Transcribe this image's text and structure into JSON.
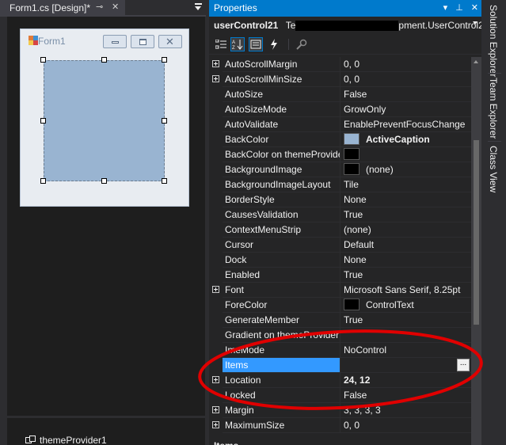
{
  "designer": {
    "tab_label": "Form1.cs [Design]*",
    "pin_icon": "pin-icon",
    "close_icon": "close-icon",
    "form": {
      "title": "Form1",
      "minimize_icon": "minimize-icon",
      "maximize_icon": "maximize-icon",
      "close_glyph": "✕"
    },
    "tray_component": "themeProvider1"
  },
  "properties": {
    "title": "Properties",
    "object_name": "userControl21",
    "object_type_prefix": "Te",
    "object_type_suffix": "pment.UserControl2",
    "toolbar": {
      "categorized_icon": "categorized-icon",
      "alphabetical_icon": "alphabetical-icon",
      "properties_icon": "properties-icon",
      "events_icon": "events-icon",
      "property-pages_icon": "property-pages-icon"
    },
    "rows": [
      {
        "name": "AutoScrollMargin",
        "value": "0, 0",
        "expandable": true
      },
      {
        "name": "AutoScrollMinSize",
        "value": "0, 0",
        "expandable": true
      },
      {
        "name": "AutoSize",
        "value": "False"
      },
      {
        "name": "AutoSizeMode",
        "value": "GrowOnly"
      },
      {
        "name": "AutoValidate",
        "value": "EnablePreventFocusChange"
      },
      {
        "name": "BackColor",
        "value": "ActiveCaption",
        "bold": true,
        "swatch": "#99b4d1"
      },
      {
        "name": "BackColor on themeProvider1",
        "value": "",
        "swatch": "#000000"
      },
      {
        "name": "BackgroundImage",
        "value": "(none)",
        "swatch": "#000000"
      },
      {
        "name": "BackgroundImageLayout",
        "value": "Tile"
      },
      {
        "name": "BorderStyle",
        "value": "None"
      },
      {
        "name": "CausesValidation",
        "value": "True"
      },
      {
        "name": "ContextMenuStrip",
        "value": "(none)"
      },
      {
        "name": "Cursor",
        "value": "Default"
      },
      {
        "name": "Dock",
        "value": "None"
      },
      {
        "name": "Enabled",
        "value": "True"
      },
      {
        "name": "Font",
        "value": "Microsoft Sans Serif, 8.25pt",
        "expandable": true
      },
      {
        "name": "ForeColor",
        "value": "ControlText",
        "swatch": "#000000"
      },
      {
        "name": "GenerateMember",
        "value": "True"
      },
      {
        "name": "Gradient on themeProvider1",
        "value": ""
      },
      {
        "name": "ImeMode",
        "value": "NoControl"
      },
      {
        "name": "Items",
        "value": "",
        "selected": true,
        "ellipsis": "..."
      },
      {
        "name": "Location",
        "value": "24, 12",
        "bold": true,
        "expandable": true
      },
      {
        "name": "Locked",
        "value": "False"
      },
      {
        "name": "Margin",
        "value": "3, 3, 3, 3",
        "expandable": true
      },
      {
        "name": "MaximumSize",
        "value": "0, 0",
        "expandable": true
      }
    ],
    "category_row": "Items"
  },
  "side_tabs": [
    "Solution Explorer",
    "Team Explorer",
    "Class View"
  ],
  "annotation_color": "#e00000",
  "accent_color": "#007acc",
  "selection_color": "#3399ff"
}
